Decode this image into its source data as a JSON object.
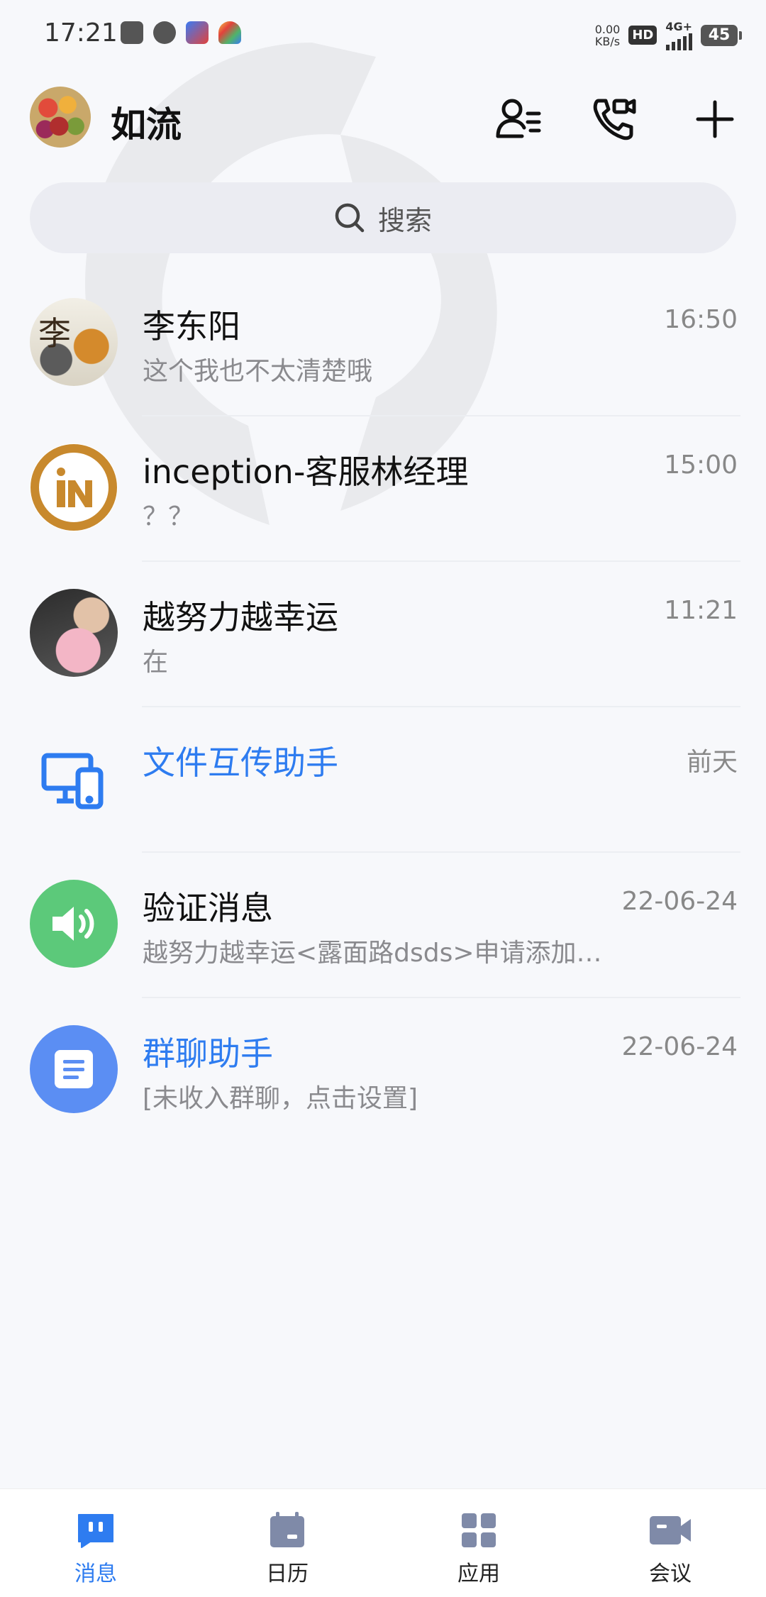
{
  "status_bar": {
    "time": "17:21",
    "speed_value": "0.00",
    "speed_unit": "KB/s",
    "hd_label": "HD",
    "network_label": "4G+",
    "battery": "45"
  },
  "header": {
    "title": "如流"
  },
  "search": {
    "label": "搜索"
  },
  "conversations": [
    {
      "name": "李东阳",
      "time": "16:50",
      "preview": "这个我也不太清楚哦",
      "avatar_text": "李"
    },
    {
      "name": "inception-客服林经理",
      "time": "15:00",
      "preview": "？？"
    },
    {
      "name": "越努力越幸运",
      "time": "11:21",
      "preview": "在"
    },
    {
      "name": "文件互传助手",
      "time": "前天",
      "preview": ""
    },
    {
      "name": "验证消息",
      "time": "22-06-24",
      "preview": "越努力越幸运<露面路dsds>申请添加…"
    },
    {
      "name": "群聊助手",
      "time": "22-06-24",
      "preview": "[未收入群聊，点击设置]"
    }
  ],
  "bottom_nav": [
    {
      "label": "消息"
    },
    {
      "label": "日历"
    },
    {
      "label": "应用"
    },
    {
      "label": "会议"
    }
  ],
  "colors": {
    "accent": "#2e7cf0",
    "nav_inactive_icon": "#7f8aa8",
    "verify_green": "#5cc97a",
    "group_blue": "#5b8ef3",
    "inception_gold": "#c8892d"
  }
}
